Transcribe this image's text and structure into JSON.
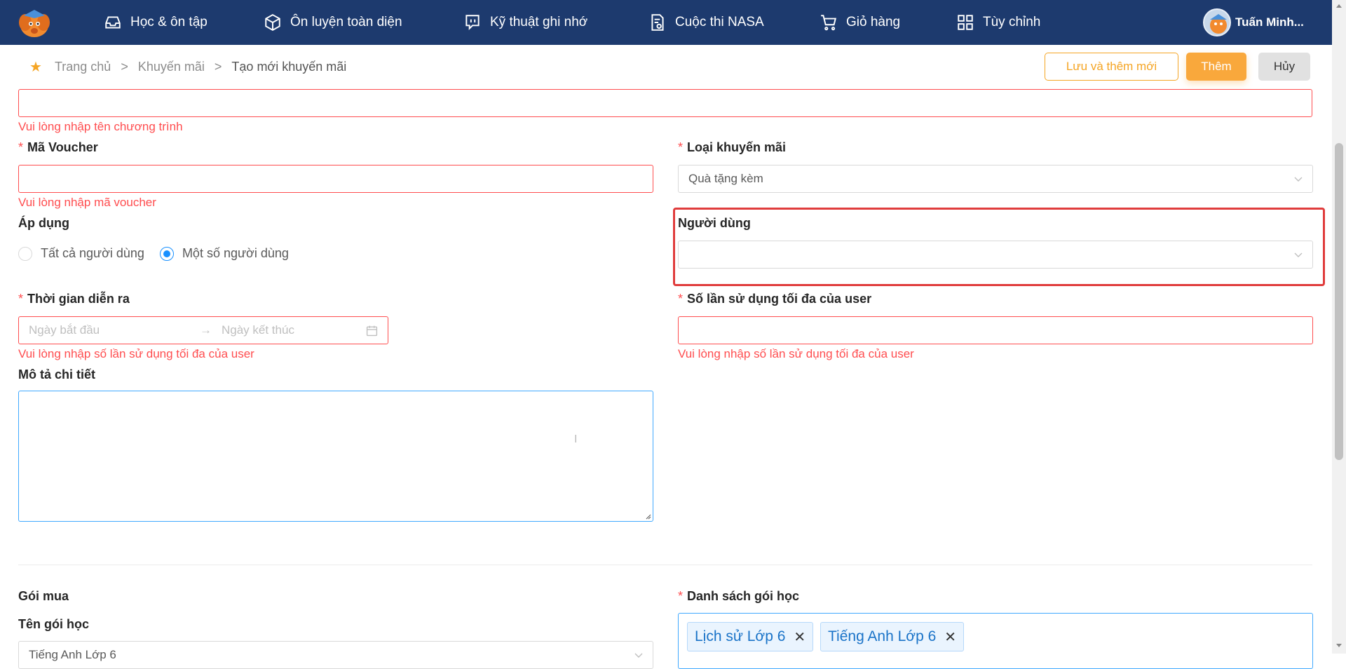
{
  "nav": {
    "items": [
      {
        "label": "Học & ôn tập",
        "icon": "inbox-icon"
      },
      {
        "label": "Ôn luyện toàn diện",
        "icon": "cube-icon"
      },
      {
        "label": "Kỹ thuật ghi nhớ",
        "icon": "chat-icon"
      },
      {
        "label": "Cuộc thi NASA",
        "icon": "document-icon"
      },
      {
        "label": "Giỏ hàng",
        "icon": "cart-icon"
      },
      {
        "label": "Tùy chỉnh",
        "icon": "grid-icon"
      }
    ],
    "user_name": "Tuấn Minh..."
  },
  "breadcrumb": {
    "home": "Trang chủ",
    "section": "Khuyến mãi",
    "current": "Tạo mới khuyến mãi",
    "separator": ">"
  },
  "actions": {
    "save_and_add": "Lưu và thêm mới",
    "add": "Thêm",
    "cancel": "Hủy"
  },
  "form": {
    "program_name_error": "Vui lòng nhập tên chương trình",
    "voucher": {
      "label": "Mã Voucher",
      "value": "",
      "error": "Vui lòng nhập mã voucher"
    },
    "promo_type": {
      "label": "Loại khuyến mãi",
      "value": "Quà tặng kèm"
    },
    "apply": {
      "label": "Áp dụng",
      "options": [
        "Tất cả người dùng",
        "Một số người dùng"
      ],
      "selected": "Một số người dùng"
    },
    "users": {
      "label": "Người dùng",
      "value": ""
    },
    "period": {
      "label": "Thời gian diễn ra",
      "start_placeholder": "Ngày bắt đầu",
      "end_placeholder": "Ngày kết thúc",
      "error": "Vui lòng nhập số lần sử dụng tối đa của user"
    },
    "max_usage": {
      "label": "Số lần sử dụng tối đa của user",
      "value": "",
      "error": "Vui lòng nhập số lần sử dụng tối đa của user"
    },
    "description": {
      "label": "Mô tả chi tiết",
      "value": ""
    },
    "package": {
      "section": "Gói mua",
      "name_label": "Tên gói học",
      "name_value": "Tiếng Anh Lớp 6"
    },
    "course_list": {
      "label": "Danh sách gói học",
      "tags": [
        "Lịch sử Lớp 6",
        "Tiếng Anh Lớp 6"
      ]
    }
  },
  "colors": {
    "topbar": "#1d3a6e",
    "accent": "#f9a83c",
    "error": "#ff4d4f",
    "focus": "#40a9ff",
    "highlight": "#e03c3c"
  }
}
